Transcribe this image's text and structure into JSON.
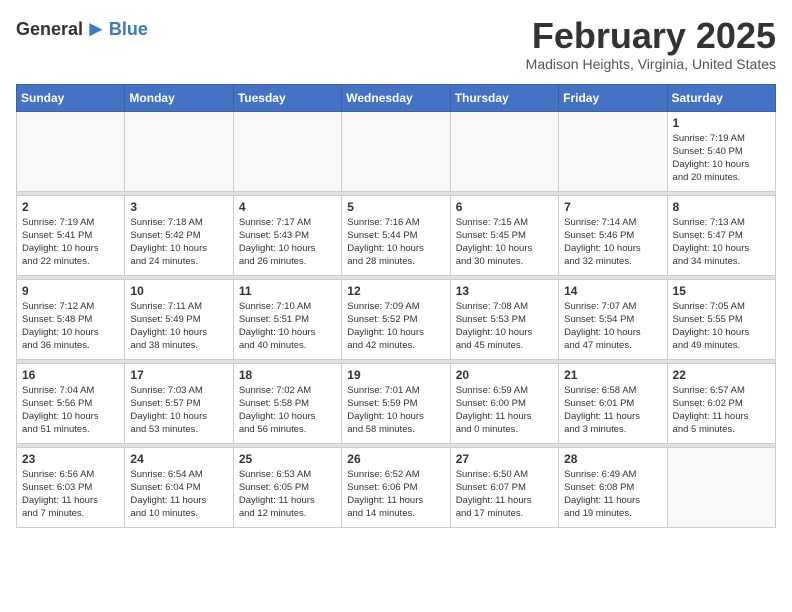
{
  "header": {
    "logo_general": "General",
    "logo_blue": "Blue",
    "month_year": "February 2025",
    "location": "Madison Heights, Virginia, United States"
  },
  "calendar": {
    "weekdays": [
      "Sunday",
      "Monday",
      "Tuesday",
      "Wednesday",
      "Thursday",
      "Friday",
      "Saturday"
    ],
    "weeks": [
      [
        {
          "day": "",
          "info": ""
        },
        {
          "day": "",
          "info": ""
        },
        {
          "day": "",
          "info": ""
        },
        {
          "day": "",
          "info": ""
        },
        {
          "day": "",
          "info": ""
        },
        {
          "day": "",
          "info": ""
        },
        {
          "day": "1",
          "info": "Sunrise: 7:19 AM\nSunset: 5:40 PM\nDaylight: 10 hours\nand 20 minutes."
        }
      ],
      [
        {
          "day": "2",
          "info": "Sunrise: 7:19 AM\nSunset: 5:41 PM\nDaylight: 10 hours\nand 22 minutes."
        },
        {
          "day": "3",
          "info": "Sunrise: 7:18 AM\nSunset: 5:42 PM\nDaylight: 10 hours\nand 24 minutes."
        },
        {
          "day": "4",
          "info": "Sunrise: 7:17 AM\nSunset: 5:43 PM\nDaylight: 10 hours\nand 26 minutes."
        },
        {
          "day": "5",
          "info": "Sunrise: 7:16 AM\nSunset: 5:44 PM\nDaylight: 10 hours\nand 28 minutes."
        },
        {
          "day": "6",
          "info": "Sunrise: 7:15 AM\nSunset: 5:45 PM\nDaylight: 10 hours\nand 30 minutes."
        },
        {
          "day": "7",
          "info": "Sunrise: 7:14 AM\nSunset: 5:46 PM\nDaylight: 10 hours\nand 32 minutes."
        },
        {
          "day": "8",
          "info": "Sunrise: 7:13 AM\nSunset: 5:47 PM\nDaylight: 10 hours\nand 34 minutes."
        }
      ],
      [
        {
          "day": "9",
          "info": "Sunrise: 7:12 AM\nSunset: 5:48 PM\nDaylight: 10 hours\nand 36 minutes."
        },
        {
          "day": "10",
          "info": "Sunrise: 7:11 AM\nSunset: 5:49 PM\nDaylight: 10 hours\nand 38 minutes."
        },
        {
          "day": "11",
          "info": "Sunrise: 7:10 AM\nSunset: 5:51 PM\nDaylight: 10 hours\nand 40 minutes."
        },
        {
          "day": "12",
          "info": "Sunrise: 7:09 AM\nSunset: 5:52 PM\nDaylight: 10 hours\nand 42 minutes."
        },
        {
          "day": "13",
          "info": "Sunrise: 7:08 AM\nSunset: 5:53 PM\nDaylight: 10 hours\nand 45 minutes."
        },
        {
          "day": "14",
          "info": "Sunrise: 7:07 AM\nSunset: 5:54 PM\nDaylight: 10 hours\nand 47 minutes."
        },
        {
          "day": "15",
          "info": "Sunrise: 7:05 AM\nSunset: 5:55 PM\nDaylight: 10 hours\nand 49 minutes."
        }
      ],
      [
        {
          "day": "16",
          "info": "Sunrise: 7:04 AM\nSunset: 5:56 PM\nDaylight: 10 hours\nand 51 minutes."
        },
        {
          "day": "17",
          "info": "Sunrise: 7:03 AM\nSunset: 5:57 PM\nDaylight: 10 hours\nand 53 minutes."
        },
        {
          "day": "18",
          "info": "Sunrise: 7:02 AM\nSunset: 5:58 PM\nDaylight: 10 hours\nand 56 minutes."
        },
        {
          "day": "19",
          "info": "Sunrise: 7:01 AM\nSunset: 5:59 PM\nDaylight: 10 hours\nand 58 minutes."
        },
        {
          "day": "20",
          "info": "Sunrise: 6:59 AM\nSunset: 6:00 PM\nDaylight: 11 hours\nand 0 minutes."
        },
        {
          "day": "21",
          "info": "Sunrise: 6:58 AM\nSunset: 6:01 PM\nDaylight: 11 hours\nand 3 minutes."
        },
        {
          "day": "22",
          "info": "Sunrise: 6:57 AM\nSunset: 6:02 PM\nDaylight: 11 hours\nand 5 minutes."
        }
      ],
      [
        {
          "day": "23",
          "info": "Sunrise: 6:56 AM\nSunset: 6:03 PM\nDaylight: 11 hours\nand 7 minutes."
        },
        {
          "day": "24",
          "info": "Sunrise: 6:54 AM\nSunset: 6:04 PM\nDaylight: 11 hours\nand 10 minutes."
        },
        {
          "day": "25",
          "info": "Sunrise: 6:53 AM\nSunset: 6:05 PM\nDaylight: 11 hours\nand 12 minutes."
        },
        {
          "day": "26",
          "info": "Sunrise: 6:52 AM\nSunset: 6:06 PM\nDaylight: 11 hours\nand 14 minutes."
        },
        {
          "day": "27",
          "info": "Sunrise: 6:50 AM\nSunset: 6:07 PM\nDaylight: 11 hours\nand 17 minutes."
        },
        {
          "day": "28",
          "info": "Sunrise: 6:49 AM\nSunset: 6:08 PM\nDaylight: 11 hours\nand 19 minutes."
        },
        {
          "day": "",
          "info": ""
        }
      ]
    ]
  }
}
